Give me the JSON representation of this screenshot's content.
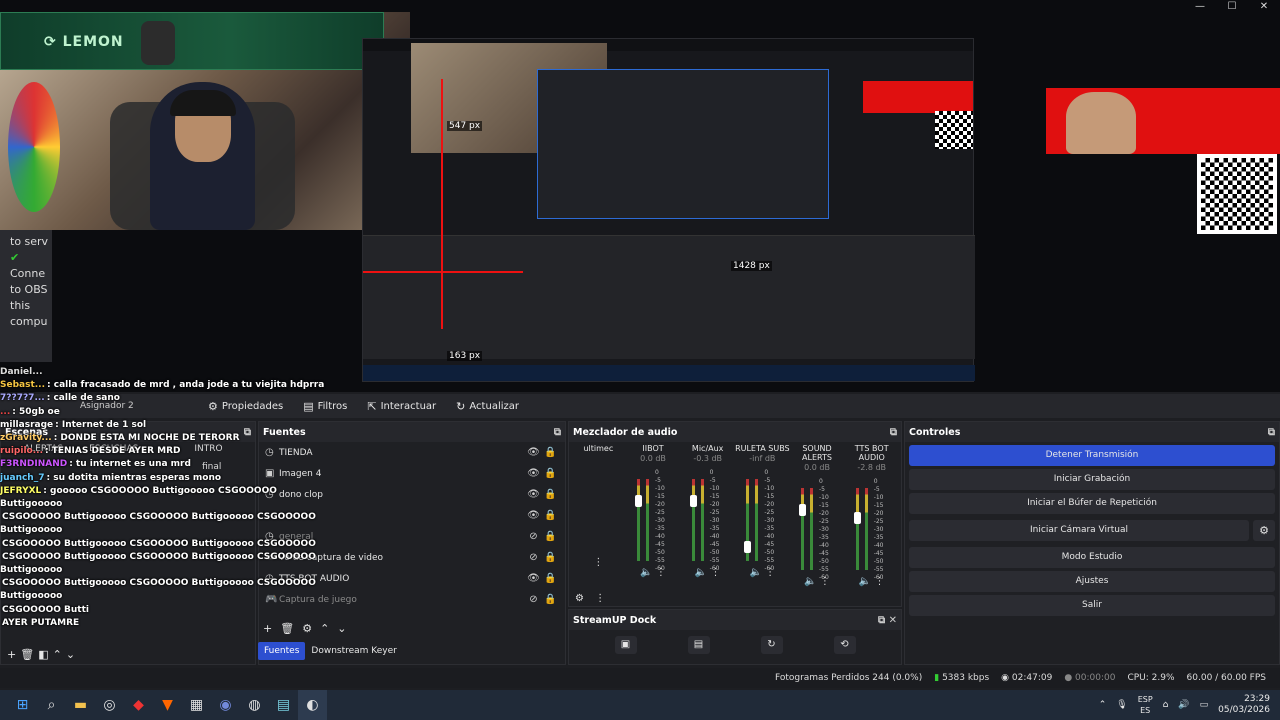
{
  "window_controls": [
    "—",
    "☐",
    "✕"
  ],
  "preview": {
    "lemon_logo": "LEMON",
    "measure_labels": [
      "547 px",
      "1428 px",
      "163 px"
    ],
    "obs_side_text": [
      "to serv",
      "Conne",
      "to OBS",
      "this",
      "compu"
    ]
  },
  "toolbar": {
    "scene_label": "Asignador 2",
    "buttons": [
      {
        "icon": "⚙",
        "label": "Propiedades"
      },
      {
        "icon": "▤",
        "label": "Filtros"
      },
      {
        "icon": "⇱",
        "label": "Interactuar"
      },
      {
        "icon": "↻",
        "label": "Actualizar"
      }
    ]
  },
  "escenas": {
    "title": "Escenas",
    "cells": [
      {
        "a": "ALERTAS",
        "b": "ESCUCHAS"
      },
      {
        "a": "INTRO",
        "b": "final"
      }
    ]
  },
  "fuentes": {
    "title": "Fuentes",
    "items": [
      {
        "icon": "◷",
        "label": "TIENDA",
        "dim": false
      },
      {
        "icon": "▣",
        "label": "Imagen 4",
        "dim": false
      },
      {
        "icon": "◷",
        "label": "dono clop",
        "dim": false
      },
      {
        "icon": "",
        "label": "",
        "dim": false
      },
      {
        "icon": "◷",
        "label": "general",
        "dim": true
      },
      {
        "icon": "▭",
        "label": "vo de captura de video",
        "dim": false
      },
      {
        "icon": "◷",
        "label": "TTS BOT AUDIO",
        "dim": false
      },
      {
        "icon": "🎮",
        "label": "Captura de juego",
        "dim": true
      }
    ],
    "tabs": [
      "Fuentes",
      "Downstream Keyer"
    ],
    "active_tab": "Fuentes"
  },
  "mixer": {
    "title": "Mezclador de audio",
    "channels": [
      {
        "name": "ultimec",
        "db": ""
      },
      {
        "name": "IIBOT",
        "db": "0.0 dB"
      },
      {
        "name": "Mic/Aux",
        "db": "-0.3 dB"
      },
      {
        "name": "RULETA SUBS",
        "db": "-inf dB"
      },
      {
        "name": "SOUND ALERTS",
        "db": "0.0 dB"
      },
      {
        "name": "TTS BOT AUDIO",
        "db": "-2.8 dB"
      }
    ],
    "scale": [
      "0",
      "-5",
      "-10",
      "-15",
      "-20",
      "-25",
      "-30",
      "-35",
      "-40",
      "-45",
      "-50",
      "-55",
      "-60"
    ]
  },
  "controles": {
    "title": "Controles",
    "buttons": [
      "Detener Transmisión",
      "Iniciar Grabación",
      "Iniciar el Búfer de Repetición",
      "Iniciar Cámara Virtual",
      "Modo Estudio",
      "Ajustes",
      "Salir"
    ]
  },
  "streamup": {
    "title": "StreamUP Dock"
  },
  "status": {
    "dropped": "Fotogramas Perdidos 244 (0.0%)",
    "bitrate": "5383 kbps",
    "stream_time": "02:47:09",
    "rec_time": "00:00:00",
    "cpu": "CPU: 2.9%",
    "fps": "60.00 / 60.00 FPS"
  },
  "chat": [
    {
      "user": "Daniel...",
      "text": ""
    },
    {
      "user": "Sebast...",
      "text": ": calla fracasado de mrd , anda jode a tu viejita hdprra"
    },
    {
      "user": "7??7?7...",
      "text": ": calle de sano"
    },
    {
      "user": "...",
      "text": ": 50gb oe"
    },
    {
      "user": "millasrage",
      "text": ": Internet de 1 sol"
    },
    {
      "user": "zGravity...",
      "text": ": DONDE ESTA MI NOCHE DE TERORR"
    },
    {
      "user": "ruipilo...",
      "text": ": TENIAS DESDE AYER MRD"
    },
    {
      "user": "F3RNDINAND",
      "text": ": tu internet es una mrd"
    },
    {
      "user": "juanch_7",
      "text": ": su dotita mientras esperas mono"
    },
    {
      "user": "JEFRYXL",
      "text": ": gooooo CSGOOOOO Buttigooooo CSGOOOOO Buttigooooo"
    },
    {
      "user": "",
      "text": "CSGOOOOO Buttigooooo CSGOOOOO Buttigooooo CSGOOOOO Buttigooooo"
    },
    {
      "user": "",
      "text": "CSGOOOOO Buttigooooo CSGOOOOO Buttigooooo CSGOOOOO"
    },
    {
      "user": "",
      "text": "CSGOOOOO Buttigooooo CSGOOOOO Buttigooooo CSGOOOOO Buttigooooo"
    },
    {
      "user": "",
      "text": "CSGOOOOO Buttigooooo CSGOOOOO Buttigooooo CSGOOOOO Buttigooooo"
    },
    {
      "user": "",
      "text": "CSGOOOOO Butti"
    },
    {
      "user": "",
      "text": "AYER PUTAMRE"
    }
  ],
  "taskbar": {
    "icons": [
      "windows-icon",
      "search-icon",
      "folder-icon",
      "obs-icon",
      "red-app-icon",
      "brave-icon",
      "calc-icon",
      "discord-icon",
      "app-icon",
      "notepad-icon",
      "steam-icon"
    ],
    "lang_top": "ESP",
    "lang_bottom": "ES",
    "time": "23:29",
    "date": "05/03/2026"
  },
  "colors": {
    "accent": "#2d4fd0",
    "lemon_green": "#1a5a3c",
    "alert_red": "#e01010"
  }
}
